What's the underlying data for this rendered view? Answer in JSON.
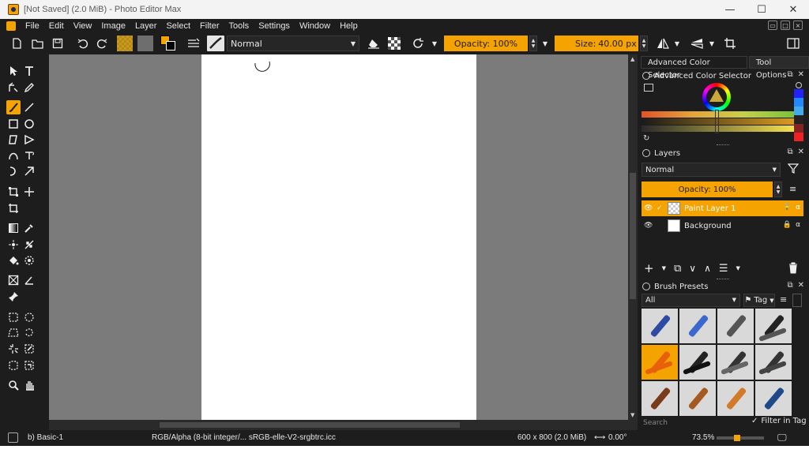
{
  "window": {
    "title": "[Not Saved]  (2.0 MiB)  - Photo Editor Max",
    "controls": {
      "minimize": "—",
      "maximize": "☐",
      "close": "✕"
    }
  },
  "menu": {
    "items": [
      "File",
      "Edit",
      "View",
      "Image",
      "Layer",
      "Select",
      "Filter",
      "Tools",
      "Settings",
      "Window",
      "Help"
    ]
  },
  "toolbar": {
    "blend_mode": "Normal",
    "opacity": "Opacity: 100%",
    "size_label": "Size:",
    "size_value": "40.00 px"
  },
  "colors": {
    "accent": "#f5a300",
    "panel_bg": "#1d1d1d",
    "canvas_bg": "#7b7b7b",
    "page": "#ffffff"
  },
  "dock": {
    "tabs": [
      "Advanced Color Selector",
      "Tool Options"
    ],
    "color_panel_title": "Advanced Color Selector",
    "layers": {
      "title": "Layers",
      "blend_mode": "Normal",
      "opacity": "Opacity: 100%",
      "items": [
        {
          "name": "Paint Layer 1",
          "selected": true
        },
        {
          "name": "Background",
          "selected": false
        }
      ]
    },
    "presets": {
      "title": "Brush Presets",
      "filter_value": "All",
      "tag_label": "Tag",
      "search_placeholder": "Search",
      "filter_in_tag": "Filter in Tag"
    }
  },
  "status": {
    "brush": "b) Basic-1",
    "color_profile": "RGB/Alpha (8-bit integer/... sRGB-elle-V2-srgbtrc.icc",
    "image_size": "600 x 800 (2.0 MiB)",
    "rotation": "0.00°",
    "zoom": "73.5%"
  }
}
